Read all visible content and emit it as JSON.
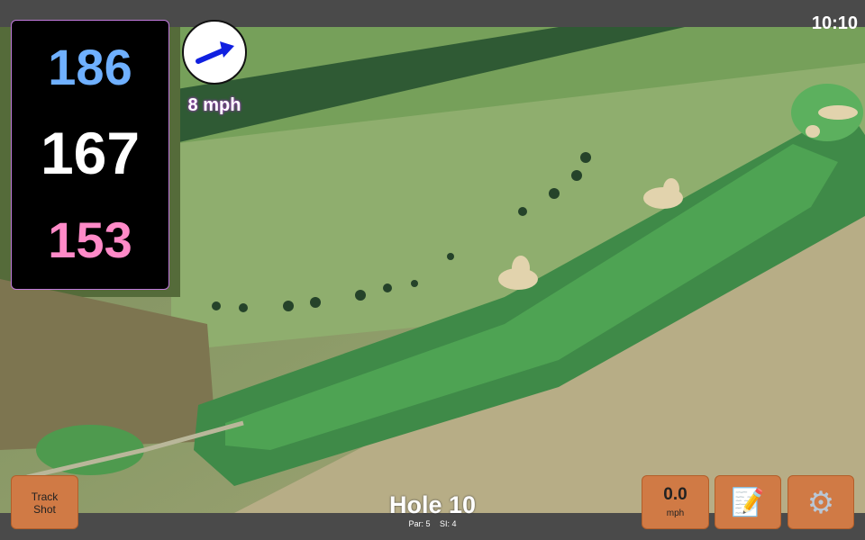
{
  "clock": "10:10",
  "distances": {
    "back": "186",
    "center": "167",
    "front": "153"
  },
  "wind": {
    "speed": "8 mph",
    "icon": "wind-direction-arrow-icon",
    "direction": "east-northeast"
  },
  "buttons": {
    "track_shot": "Track\nShot",
    "speed_value": "0.0",
    "speed_unit": "mph",
    "notes_icon": "notepad-icon",
    "settings_icon": "gear-icon"
  },
  "hole": {
    "title": "Hole 10",
    "par": "Par: 5",
    "si": "SI: 4"
  },
  "colors": {
    "back_distance": "#6fb0ff",
    "center_distance": "#ffffff",
    "front_distance": "#ff8ac8",
    "button": "#d07a45",
    "panel_border": "#c07adb",
    "wind_arrow": "#1020e0"
  }
}
